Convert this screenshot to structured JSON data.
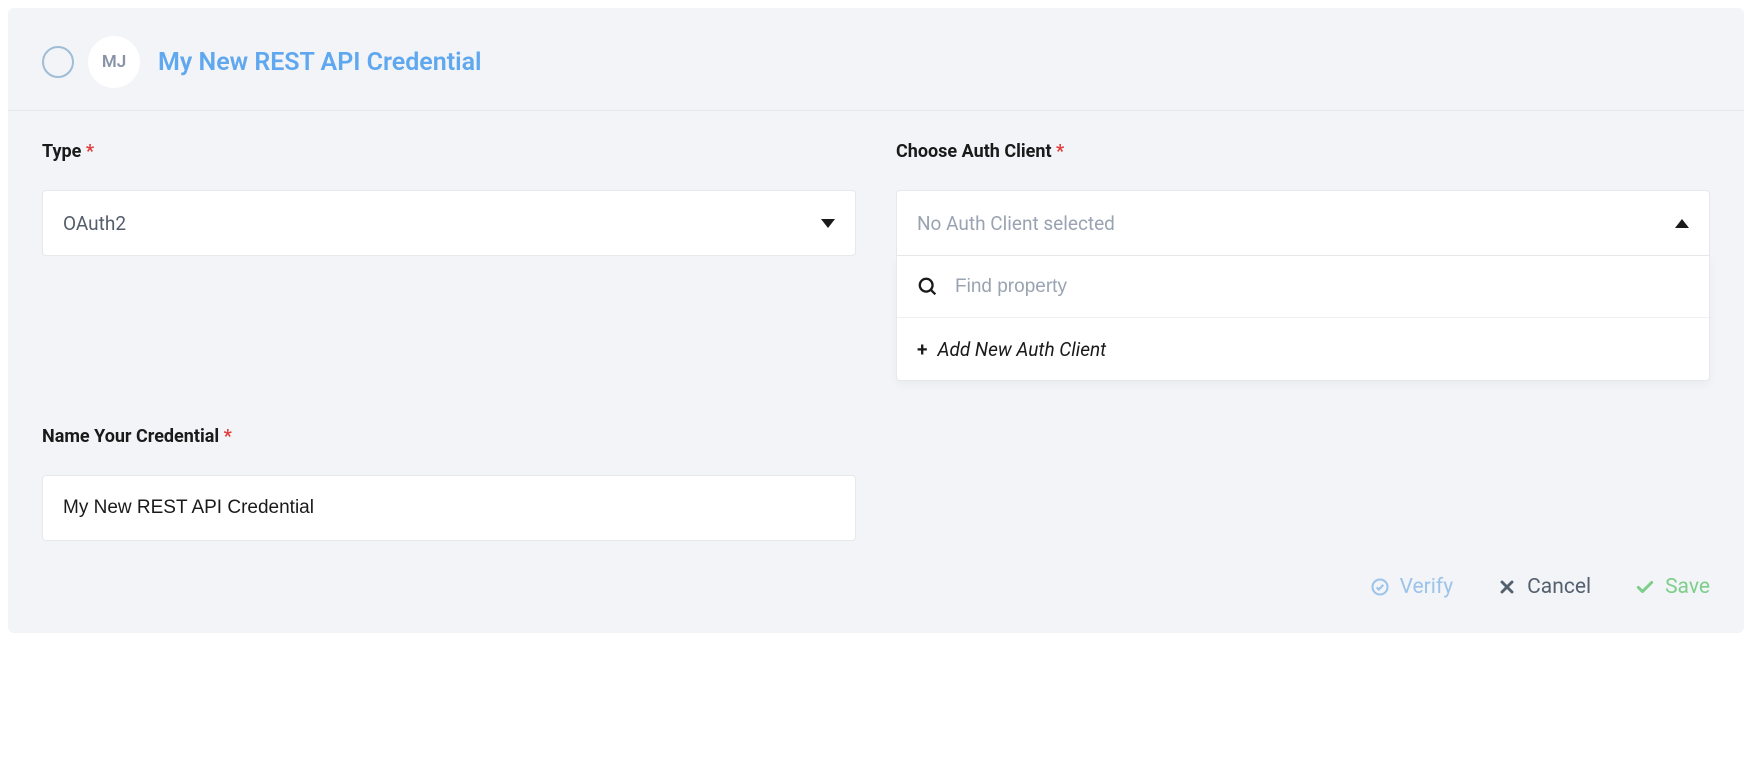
{
  "header": {
    "avatar_initials": "MJ",
    "title": "My New REST API Credential"
  },
  "form": {
    "type": {
      "label": "Type",
      "value": "OAuth2"
    },
    "auth_client": {
      "label": "Choose Auth Client",
      "placeholder": "No Auth Client selected",
      "search_placeholder": "Find property",
      "add_label": "Add New Auth Client"
    },
    "name": {
      "label": "Name Your Credential",
      "value": "My New REST API Credential"
    }
  },
  "actions": {
    "verify": "Verify",
    "cancel": "Cancel",
    "save": "Save"
  },
  "required_marker": "*"
}
